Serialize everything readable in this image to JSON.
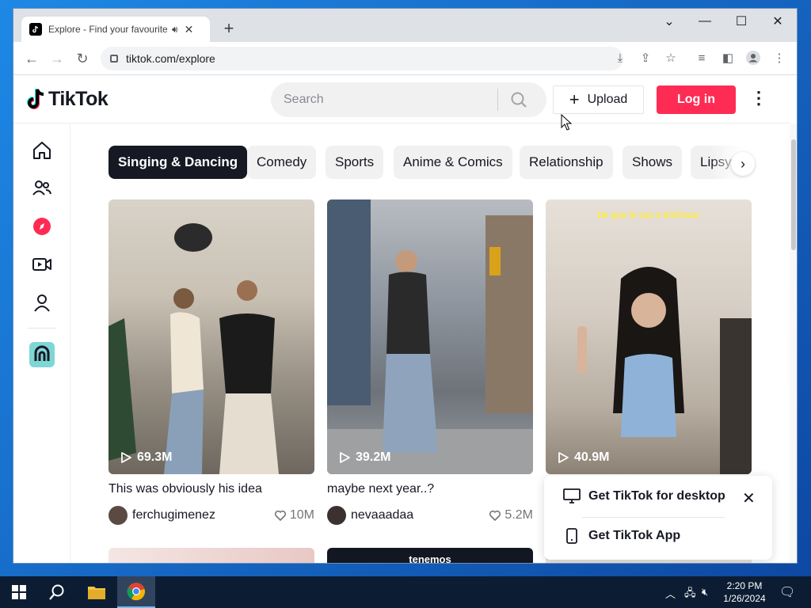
{
  "browser": {
    "tab_title": "Explore - Find your favourite",
    "url": "tiktok.com/explore"
  },
  "header": {
    "logo_text": "TikTok",
    "search_placeholder": "Search",
    "upload_label": "Upload",
    "login_label": "Log in"
  },
  "sidebar": {
    "items": [
      {
        "name": "home-icon"
      },
      {
        "name": "following-icon"
      },
      {
        "name": "explore-icon"
      },
      {
        "name": "live-icon"
      },
      {
        "name": "profile-icon"
      },
      {
        "name": "creator-icon"
      }
    ]
  },
  "categories": [
    "Singing & Dancing",
    "Comedy",
    "Sports",
    "Anime & Comics",
    "Relationship",
    "Shows",
    "Lipsync"
  ],
  "videos": [
    {
      "views": "69.3M",
      "caption": "This was obviously his idea",
      "author": "ferchugimenez",
      "likes": "10M",
      "overlay": ""
    },
    {
      "views": "39.2M",
      "caption": "maybe next year..?",
      "author": "nevaaadaa",
      "likes": "5.2M",
      "overlay": ""
    },
    {
      "views": "40.9M",
      "caption": "",
      "author": "",
      "likes": "",
      "overlay": "De que te vas a disfrazar"
    }
  ],
  "row2": {
    "partial_text": "tenemos"
  },
  "popup": {
    "desktop_label": "Get TikTok for desktop",
    "app_label": "Get TikTok App"
  },
  "taskbar": {
    "time": "2:20 PM",
    "date": "1/26/2024"
  },
  "colors": {
    "brand_red": "#fe2c55",
    "chip_active": "#161823",
    "chip_bg": "#f1f1f2"
  }
}
